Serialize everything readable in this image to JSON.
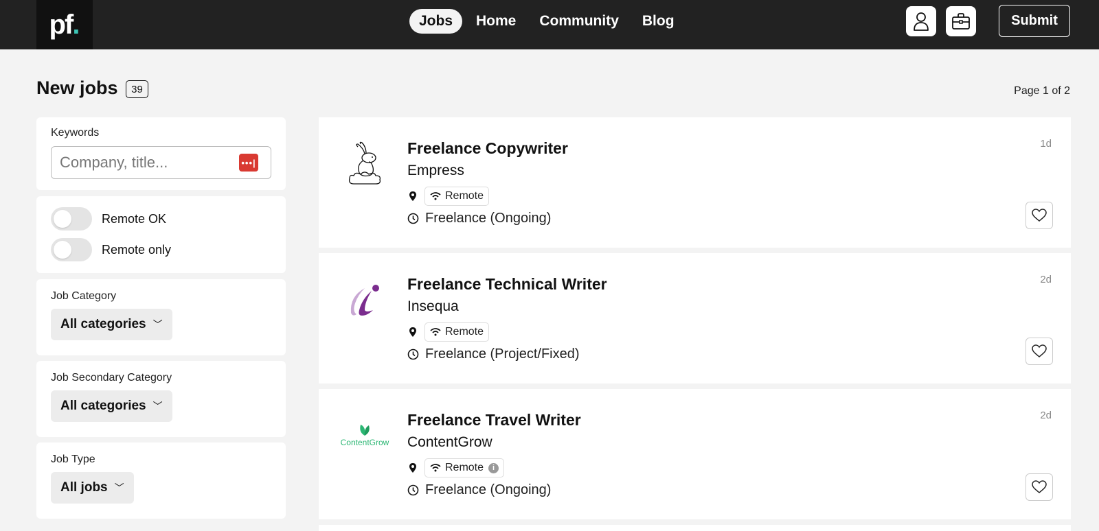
{
  "nav": {
    "logo_text": "pf",
    "logo_dot": ".",
    "items": [
      {
        "label": "Jobs",
        "active": true
      },
      {
        "label": "Home",
        "active": false
      },
      {
        "label": "Community",
        "active": false
      },
      {
        "label": "Blog",
        "active": false
      }
    ],
    "profile_icon": "user-icon",
    "jobs_icon": "briefcase-icon",
    "submit_label": "Submit"
  },
  "header": {
    "title": "New jobs",
    "count": "39",
    "page_info": "Page 1 of 2"
  },
  "filters": {
    "keywords_label": "Keywords",
    "keywords_placeholder": "Company, title...",
    "keywords_value": "",
    "remote_ok_label": "Remote OK",
    "remote_ok_on": false,
    "remote_only_label": "Remote only",
    "remote_only_on": false,
    "category_label": "Job Category",
    "category_value": "All categories",
    "secondary_category_label": "Job Secondary Category",
    "secondary_category_value": "All categories",
    "job_type_label": "Job Type",
    "job_type_value": "All jobs"
  },
  "jobs": [
    {
      "title": "Freelance Copywriter",
      "company": "Empress",
      "logo_icon": "rabbit-logo-icon",
      "location_tag": "Remote",
      "has_info": false,
      "type": "Freelance (Ongoing)",
      "age": "1d"
    },
    {
      "title": "Freelance Technical Writer",
      "company": "Insequa",
      "logo_icon": "insequa-logo-icon",
      "location_tag": "Remote",
      "has_info": false,
      "type": "Freelance (Project/Fixed)",
      "age": "2d"
    },
    {
      "title": "Freelance Travel Writer",
      "company": "ContentGrow",
      "logo_icon": "contentgrow-logo-icon",
      "logo_text": "ContentGrow",
      "location_tag": "Remote",
      "has_info": true,
      "type": "Freelance (Ongoing)",
      "age": "2d"
    }
  ],
  "colors": {
    "topbar": "#222222",
    "accent_dot": "#3cc4b5",
    "password_icon": "#d93a32",
    "insequa_purple": "#7b2d8e",
    "contentgrow_green": "#2bb673"
  }
}
